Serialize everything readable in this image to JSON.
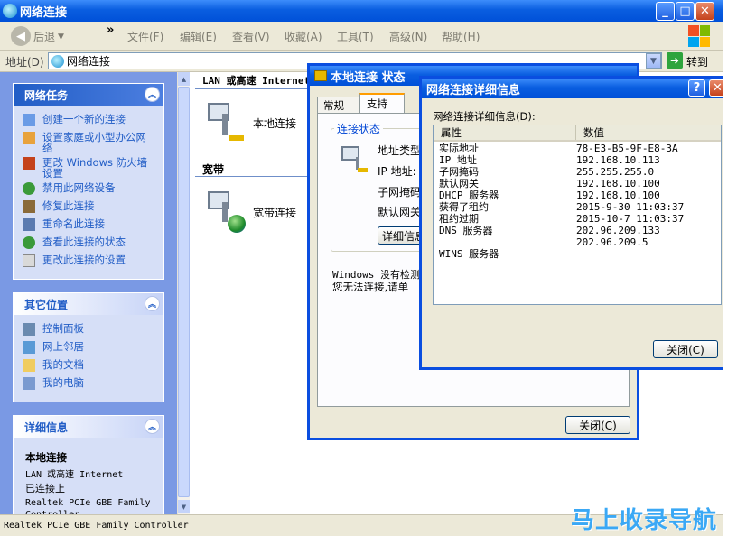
{
  "window": {
    "title": "网络连接"
  },
  "menu": {
    "back": "后退",
    "forward_chevron": "»",
    "items": [
      "文件(F)",
      "编辑(E)",
      "查看(V)",
      "收藏(A)",
      "工具(T)",
      "高级(N)",
      "帮助(H)"
    ]
  },
  "address": {
    "label": "地址(D)",
    "value": "网络连接",
    "go": "转到"
  },
  "tasks_panel": {
    "title": "网络任务",
    "items": [
      "创建一个新的连接",
      "设置家庭或小型办公网络",
      "更改 Windows 防火墙设置",
      "禁用此网络设备",
      "修复此连接",
      "重命名此连接",
      "查看此连接的状态",
      "更改此连接的设置"
    ]
  },
  "other_panel": {
    "title": "其它位置",
    "items": [
      "控制面板",
      "网上邻居",
      "我的文档",
      "我的电脑"
    ]
  },
  "details_panel": {
    "title": "详细信息",
    "name": "本地连接",
    "type": "LAN 或高速 Internet",
    "status": "已连接上",
    "device": "Realtek PCIe GBE Family Controller"
  },
  "content": {
    "group1": "LAN 或高速 Internet",
    "item1": "本地连接",
    "group2": "宽带",
    "item2": "宽带连接"
  },
  "statusbar": {
    "text": "Realtek PCIe GBE Family Controller"
  },
  "status_dialog": {
    "title": "本地连接 状态",
    "tabs": [
      "常规",
      "支持"
    ],
    "groupbox": "连接状态",
    "fields": [
      "地址类型",
      "IP 地址:",
      "子网掩码",
      "默认网关"
    ],
    "details_button": "详细信息",
    "text1": "Windows 没有检测",
    "text2": "您无法连接,请单",
    "close": "关闭(C)"
  },
  "details_dialog": {
    "title": "网络连接详细信息",
    "help": "?",
    "label": "网络连接详细信息(D):",
    "col1": "属性",
    "col2": "数值",
    "rows": [
      {
        "k": "实际地址",
        "v": "78-E3-B5-9F-E8-3A"
      },
      {
        "k": "IP 地址",
        "v": "192.168.10.113"
      },
      {
        "k": "子网掩码",
        "v": "255.255.255.0"
      },
      {
        "k": "默认网关",
        "v": "192.168.10.100"
      },
      {
        "k": "DHCP 服务器",
        "v": "192.168.10.100"
      },
      {
        "k": "获得了租约",
        "v": "2015-9-30 11:03:37"
      },
      {
        "k": "租约过期",
        "v": "2015-10-7 11:03:37"
      },
      {
        "k": "DNS 服务器",
        "v": "202.96.209.133"
      },
      {
        "k": "",
        "v": "202.96.209.5"
      },
      {
        "k": "WINS 服务器",
        "v": ""
      }
    ],
    "close": "关闭(C)"
  },
  "watermark": "马上收录导航"
}
